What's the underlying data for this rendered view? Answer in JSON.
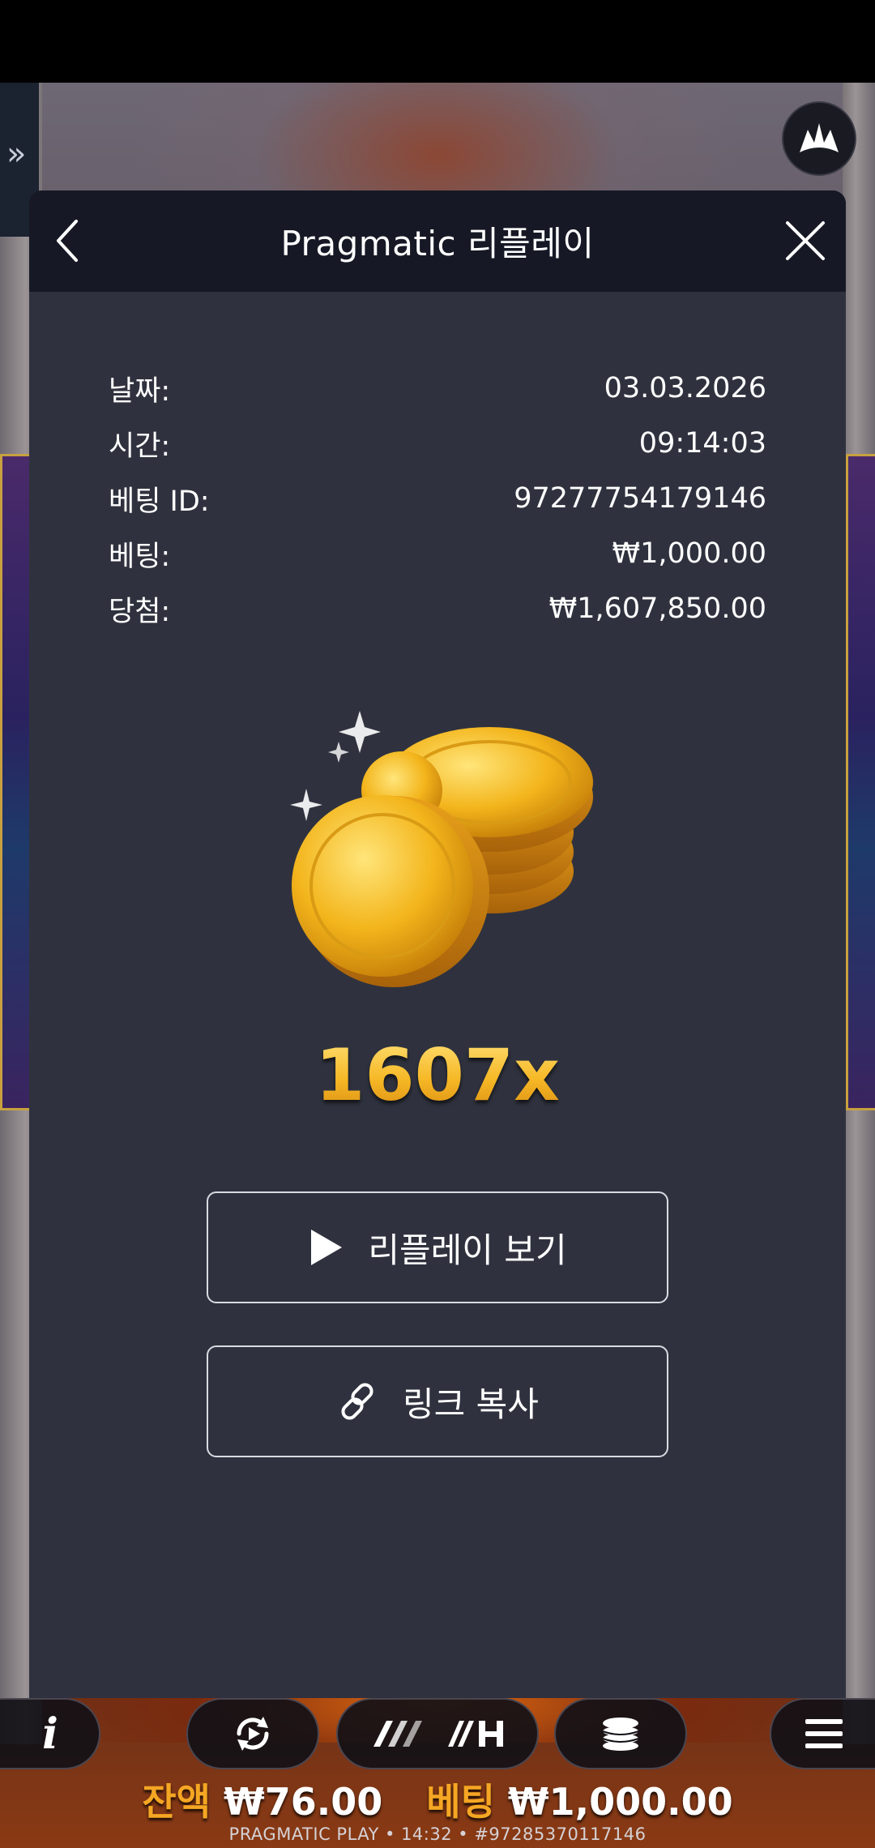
{
  "modal": {
    "title": "Pragmatic 리플레이",
    "details": [
      {
        "label": "날짜:",
        "value": "03.03.2026"
      },
      {
        "label": "시간:",
        "value": "09:14:03"
      },
      {
        "label": "베팅 ID:",
        "value": "97277754179146"
      },
      {
        "label": "베팅:",
        "value": "₩1,000.00"
      },
      {
        "label": "당첨:",
        "value": "₩1,607,850.00"
      }
    ],
    "multiplier": "1607x",
    "watch_replay_label": "리플레이 보기",
    "copy_link_label": "링크 복사"
  },
  "game_bar": {
    "balance_label": "잔액",
    "balance_value": "₩76.00",
    "bet_label": "베팅",
    "bet_value": "₩1,000.00",
    "info_label": "i",
    "footer": "PRAGMATIC PLAY • 14:32 • #97285370117146"
  },
  "icons": {
    "back": "chevron-left-icon",
    "close": "close-icon",
    "play": "play-icon",
    "link": "link-icon",
    "side_expand": "double-chevron-right-icon",
    "brand": "pragmatic-logo-icon",
    "autoplay": "autoplay-icon",
    "turbo": "turbo-icon",
    "quick_hyper": "hyper-spin-icon",
    "coins": "coins-icon",
    "menu": "menu-icon"
  },
  "colors": {
    "modal_bg": "#2f323e",
    "header_bg": "#161925",
    "accent_gold": "#f5a623"
  }
}
